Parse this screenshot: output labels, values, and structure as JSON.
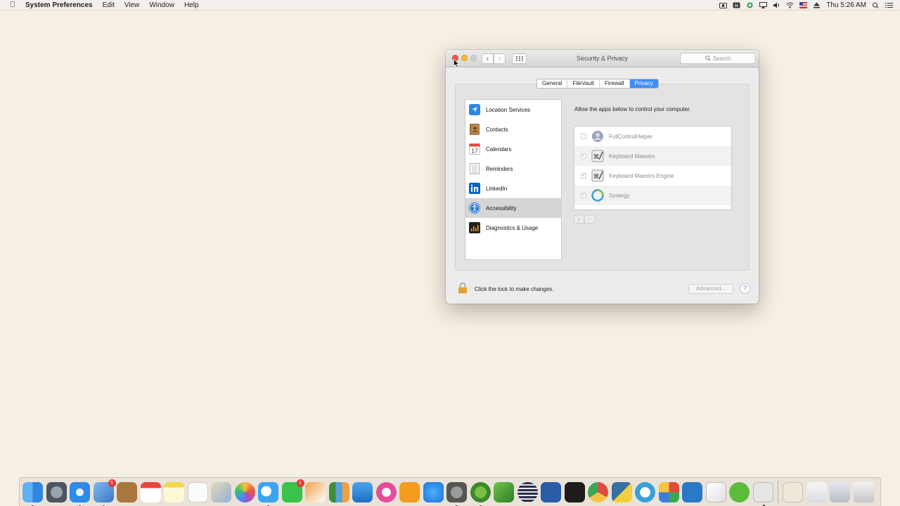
{
  "menubar": {
    "app_name": "System Preferences",
    "menus": [
      "Edit",
      "View",
      "Window",
      "Help"
    ],
    "clock": "Thu 5:26 AM"
  },
  "window": {
    "title": "Security & Privacy",
    "search_placeholder": "Search",
    "tabs": [
      {
        "label": "General",
        "active": false
      },
      {
        "label": "FileVault",
        "active": false
      },
      {
        "label": "Firewall",
        "active": false
      },
      {
        "label": "Privacy",
        "active": true
      }
    ],
    "sidebar": [
      {
        "label": "Location Services",
        "icon": "location-arrow-icon",
        "selected": false
      },
      {
        "label": "Contacts",
        "icon": "contacts-book-icon",
        "selected": false
      },
      {
        "label": "Calendars",
        "icon": "calendar-icon",
        "selected": false
      },
      {
        "label": "Reminders",
        "icon": "reminders-list-icon",
        "selected": false
      },
      {
        "label": "LinkedIn",
        "icon": "linkedin-icon",
        "selected": false
      },
      {
        "label": "Accessibility",
        "icon": "accessibility-icon",
        "selected": true
      },
      {
        "label": "Diagnostics & Usage",
        "icon": "diagnostics-icon",
        "selected": false
      }
    ],
    "allow_text": "Allow the apps below to control your computer.",
    "apps": [
      {
        "name": "FullControlHelper",
        "checked": false,
        "icon": "fullcontrol-helper-icon"
      },
      {
        "name": "Keyboard Maestro",
        "checked": true,
        "icon": "keyboard-maestro-icon"
      },
      {
        "name": "Keyboard Maestro Engine",
        "checked": true,
        "icon": "keyboard-maestro-engine-icon"
      },
      {
        "name": "Synergy",
        "checked": true,
        "icon": "synergy-icon"
      }
    ],
    "add_symbol": "+",
    "remove_symbol": "−",
    "lock_text": "Click the lock to make changes.",
    "advanced_label": "Advanced...",
    "help_symbol": "?"
  },
  "dock": {
    "badges": {
      "mail": "5",
      "facetime": "1"
    }
  },
  "colors": {
    "desktop": "#f6efe4",
    "accent": "#3f8ff7",
    "selected_row": "#d6d6d6"
  }
}
